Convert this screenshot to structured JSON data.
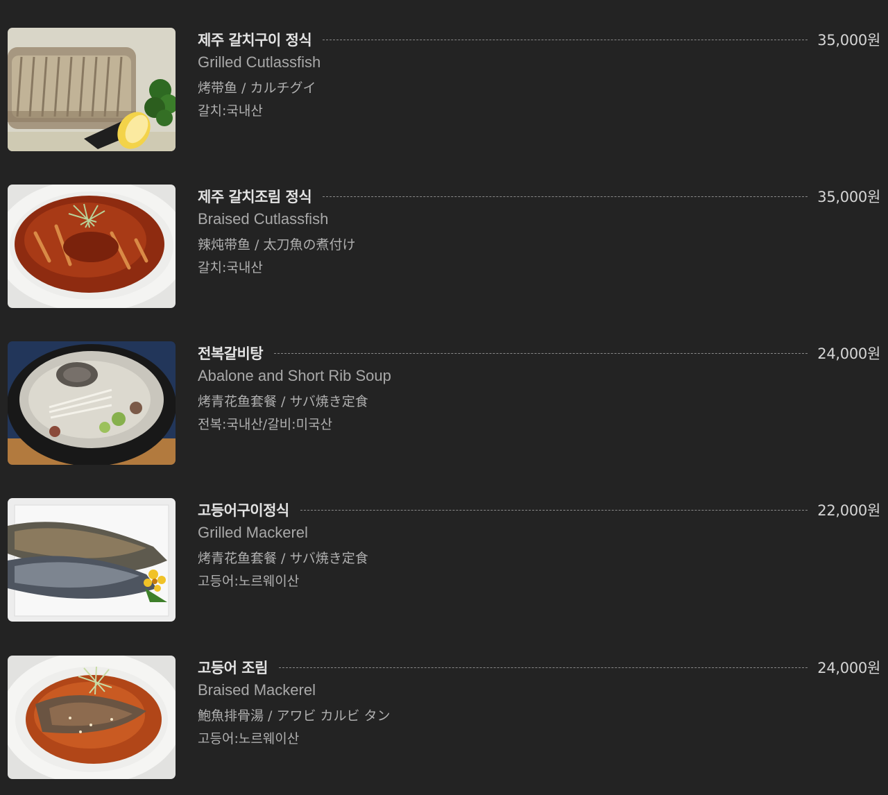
{
  "menu": {
    "items": [
      {
        "name": "제주 갈치구이 정식",
        "price": "35,000원",
        "english": "Grilled Cutlassfish",
        "translation": "烤带鱼 / カルチグイ",
        "origin": "갈치:국내산",
        "image_icon": "grilled-cutlassfish-photo"
      },
      {
        "name": "제주 갈치조림 정식",
        "price": "35,000원",
        "english": "Braised Cutlassfish",
        "translation": "辣炖带鱼 / 太刀魚の煮付け",
        "origin": "갈치:국내산",
        "image_icon": "braised-cutlassfish-photo"
      },
      {
        "name": "전복갈비탕",
        "price": "24,000원",
        "english": "Abalone and Short Rib Soup",
        "translation": "烤青花鱼套餐 / サバ焼き定食",
        "origin": "전복:국내산/갈비:미국산",
        "image_icon": "abalone-rib-soup-photo"
      },
      {
        "name": "고등어구이정식",
        "price": "22,000원",
        "english": "Grilled Mackerel",
        "translation": "烤青花鱼套餐 / サバ焼き定食",
        "origin": "고등어:노르웨이산",
        "image_icon": "grilled-mackerel-photo"
      },
      {
        "name": "고등어 조림",
        "price": "24,000원",
        "english": "Braised Mackerel",
        "translation": "鮑魚排骨湯 / アワビ カルビ タン",
        "origin": "고등어:노르웨이산",
        "image_icon": "braised-mackerel-photo"
      }
    ]
  },
  "colors": {
    "background": "#232323",
    "title": "#e3e3e3",
    "text": "#b0b0b0",
    "leader": "#8a8a8a"
  }
}
